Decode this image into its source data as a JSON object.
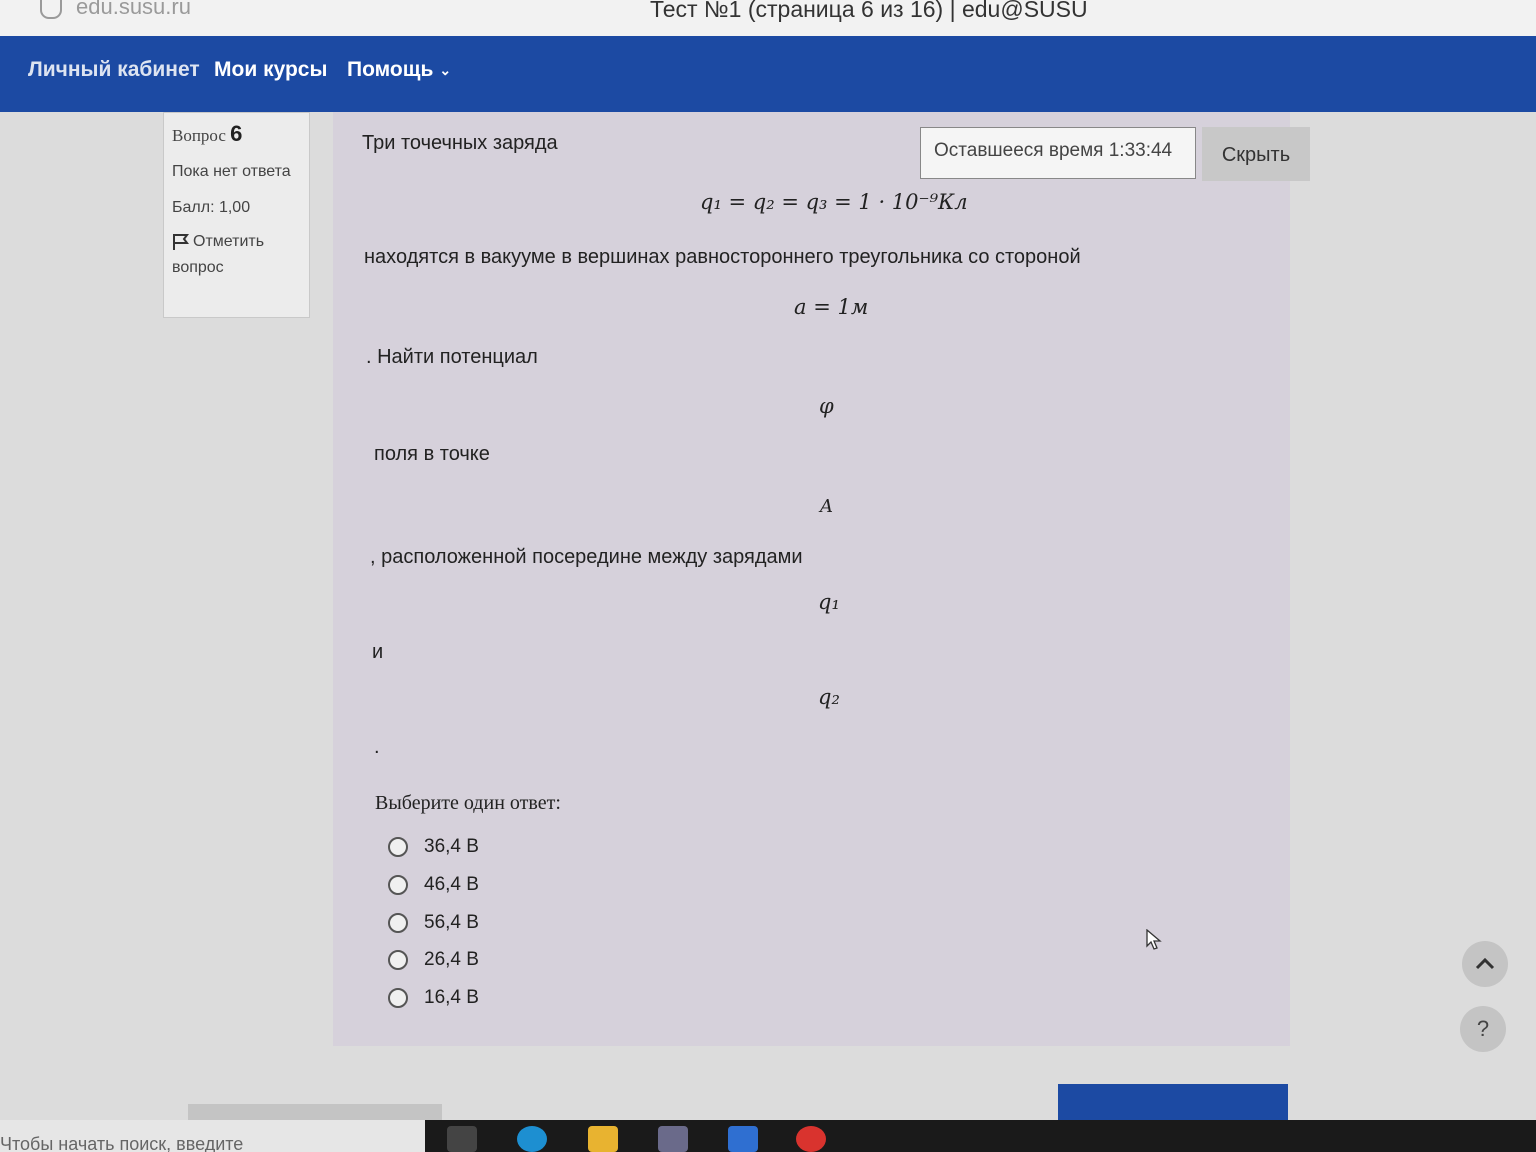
{
  "browser": {
    "url_text": "edu.susu.ru",
    "tab_title": "Тест №1 (страница 6 из 16) | edu@SUSU"
  },
  "nav": {
    "items": [
      "Личный кабинет",
      "Мои курсы",
      "Помощь"
    ]
  },
  "question_info": {
    "label": "Вопрос",
    "number": "6",
    "state": "Пока нет ответа",
    "grade": "Балл: 1,00",
    "flag": "Отметить вопрос"
  },
  "timer": {
    "label": "Оставшееся время 1:33:44",
    "hide": "Скрыть"
  },
  "question": {
    "intro": "Три точечных заряда",
    "formula_charges": "q₁ = q₂ = q₃ = 1 · 10⁻⁹Кл",
    "line2": "находятся в вакууме в вершинах равностороннего треугольника со стороной",
    "formula_side": "a = 1м",
    "line3": ". Найти потенциал",
    "formula_phi": "φ",
    "line4": "поля в точке",
    "formula_point": "A",
    "line5": ", расположенной посередине между зарядами",
    "formula_q1": "q₁",
    "line6": "и",
    "formula_q2": "q₂",
    "line7": "."
  },
  "answer": {
    "prompt": "Выберите один ответ:",
    "options": [
      "36,4 В",
      "46,4 В",
      "56,4 В",
      "26,4 В",
      "16,4 В"
    ]
  },
  "taskbar": {
    "search_text": "Чтобы начать поиск, введите"
  },
  "colors": {
    "nav_bg": "#1c4aa3",
    "content_bg": "#d6d1db"
  },
  "icons": [
    "shield-icon",
    "chevron-down-icon",
    "flag-icon",
    "radio-icon",
    "arrow-up-icon",
    "question-icon"
  ]
}
